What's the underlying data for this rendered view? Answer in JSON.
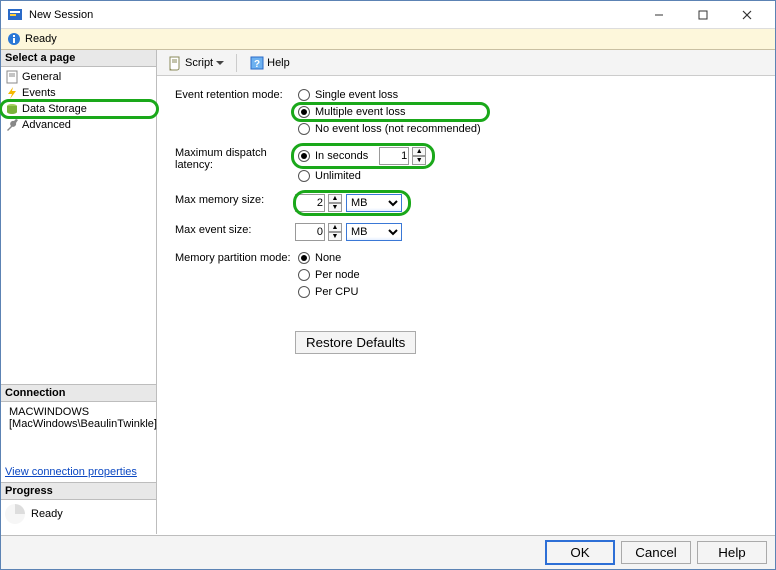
{
  "window": {
    "title": "New Session"
  },
  "status": {
    "ready": "Ready"
  },
  "sidebar": {
    "selectLabel": "Select a page",
    "items": [
      {
        "label": "General"
      },
      {
        "label": "Events"
      },
      {
        "label": "Data Storage"
      },
      {
        "label": "Advanced"
      }
    ],
    "connectionLabel": "Connection",
    "server": "MACWINDOWS",
    "serverUser": "[MacWindows\\BeaulinTwinkle]",
    "viewProps": "View connection properties",
    "progressLabel": "Progress",
    "progressStatus": "Ready"
  },
  "toolbar": {
    "script": "Script",
    "help": "Help"
  },
  "form": {
    "retentionLabel": "Event retention mode:",
    "retention": {
      "single": "Single event loss",
      "multiple": "Multiple event loss",
      "none": "No event loss (not recommended)"
    },
    "dispatchLabel": "Maximum dispatch latency:",
    "dispatch": {
      "inSeconds": "In seconds",
      "secondsVal": "1",
      "unlimited": "Unlimited"
    },
    "maxMemLabel": "Max memory size:",
    "maxMemVal": "2",
    "maxMemUnit": "MB",
    "maxEventLabel": "Max event size:",
    "maxEventVal": "0",
    "maxEventUnit": "MB",
    "partitionLabel": "Memory partition mode:",
    "partition": {
      "none": "None",
      "perNode": "Per node",
      "perCPU": "Per CPU"
    },
    "restore": "Restore Defaults"
  },
  "footer": {
    "ok": "OK",
    "cancel": "Cancel",
    "help": "Help"
  }
}
